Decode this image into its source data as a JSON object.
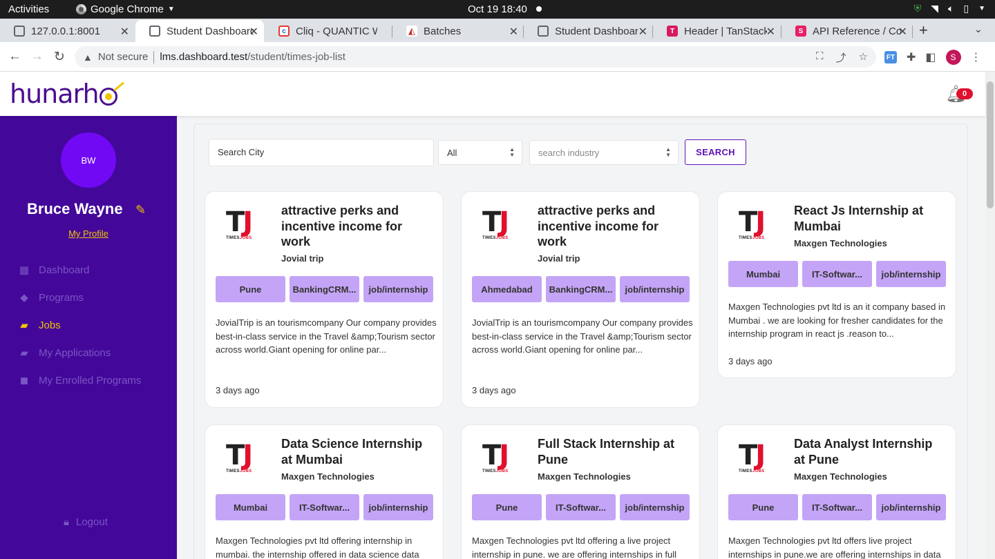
{
  "os": {
    "activities": "Activities",
    "app_name": "Google Chrome",
    "clock": "Oct 19  18:40"
  },
  "tabs": [
    {
      "title": "127.0.0.1:8001"
    },
    {
      "title": "Student Dashboard"
    },
    {
      "title": "Cliq - QUANTIC WEB"
    },
    {
      "title": "Batches"
    },
    {
      "title": "Student Dashboard"
    },
    {
      "title": "Header | TanStack"
    },
    {
      "title": "API Reference / Components"
    }
  ],
  "address": {
    "security": "Not secure",
    "host": "lms.dashboard.test",
    "path": "/student/times-job-list"
  },
  "header": {
    "logo_text": "hunarh",
    "notification_count": "0"
  },
  "sidebar": {
    "avatar_initials": "BW",
    "user_name": "Bruce Wayne",
    "profile_link": "My Profile",
    "items": [
      {
        "label": "Dashboard"
      },
      {
        "label": "Programs"
      },
      {
        "label": "Jobs"
      },
      {
        "label": "My Applications"
      },
      {
        "label": "My Enrolled Programs"
      }
    ],
    "logout": "Logout"
  },
  "filters": {
    "city_placeholder": "Search City",
    "type_value": "All",
    "industry_placeholder": "search industry",
    "search_label": "SEARCH"
  },
  "logo_tj": {
    "big_t": "T",
    "big_j": "J",
    "small_a": "TIMES",
    "small_b": "JOBS"
  },
  "jobs": [
    {
      "title": "attractive perks and incentive income for work",
      "company": "Jovial trip",
      "tags": [
        "Pune",
        "BankingCRM...",
        "job/internship"
      ],
      "description": "JovialTrip is an tourismcompany Our company provides best-in-class service in the Travel &amp;Tourism sector across world.Giant opening for online par...",
      "posted": "3 days ago"
    },
    {
      "title": "attractive perks and incentive income for work",
      "company": "Jovial trip",
      "tags": [
        "Ahmedabad",
        "BankingCRM...",
        "job/internship"
      ],
      "description": "JovialTrip is an tourismcompany Our company provides best-in-class service in the Travel &amp;Tourism sector across world.Giant opening for online par...",
      "posted": "3 days ago"
    },
    {
      "title": "React Js Internship at Mumbai",
      "company": "Maxgen Technologies",
      "tags": [
        "Mumbai",
        "IT-Softwar...",
        "job/internship"
      ],
      "description": "Maxgen Technologies pvt ltd is an it company based in Mumbai . we are looking for fresher candidates for the internship program in react js .reason to...",
      "posted": "3 days ago"
    },
    {
      "title": "Data Science Internship at Mumbai",
      "company": "Maxgen Technologies",
      "tags": [
        "Mumbai",
        "IT-Softwar...",
        "job/internship"
      ],
      "description": "Maxgen Technologies pvt ltd offering internship in mumbai. the internship offered in data science data",
      "posted": ""
    },
    {
      "title": "Full Stack Internship at Pune",
      "company": "Maxgen Technologies",
      "tags": [
        "Pune",
        "IT-Softwar...",
        "job/internship"
      ],
      "description": "Maxgen Technologies pvt ltd offering a live project internship in pune. we are offering internships in full",
      "posted": ""
    },
    {
      "title": "Data Analyst Internship at Pune",
      "company": "Maxgen Technologies",
      "tags": [
        "Pune",
        "IT-Softwar...",
        "job/internship"
      ],
      "description": "Maxgen Technologies pvt ltd offers live project internships in pune.we are offering internships in data",
      "posted": ""
    }
  ]
}
